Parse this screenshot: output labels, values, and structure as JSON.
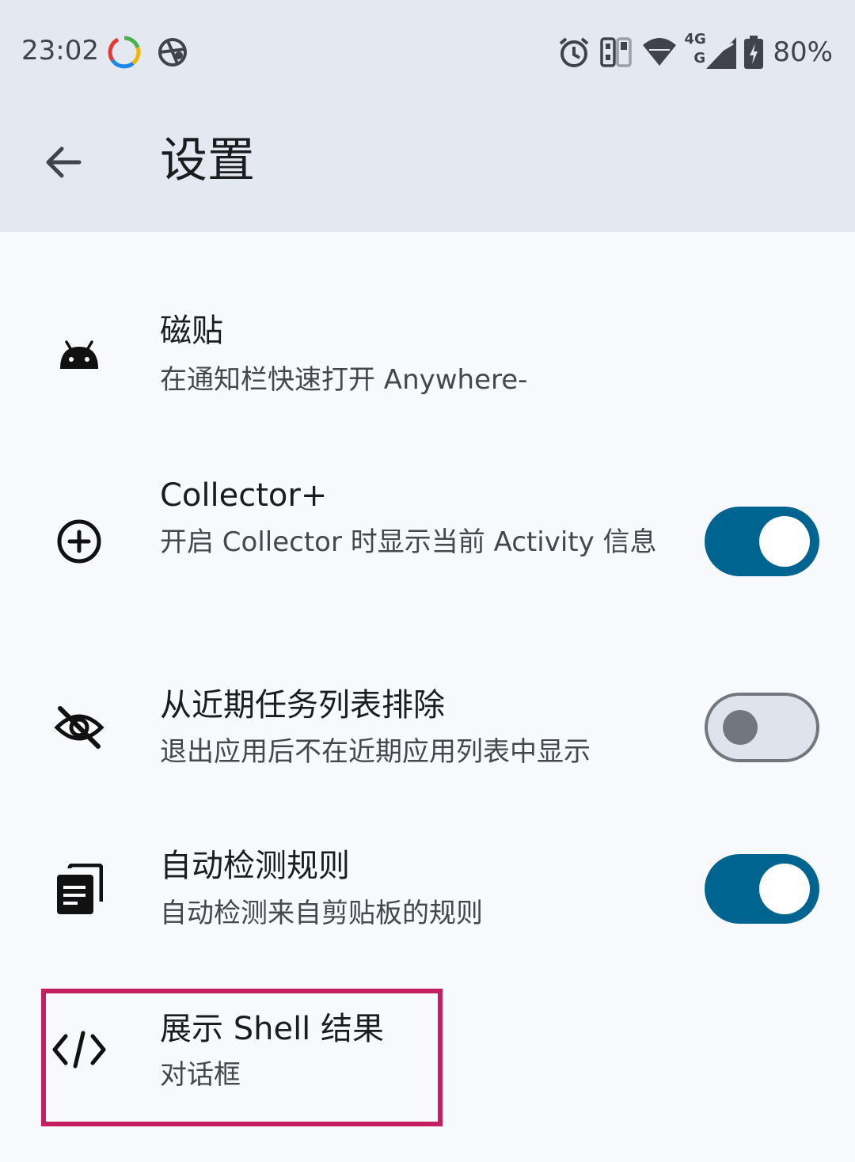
{
  "status_bar": {
    "time": "23:02",
    "left_icons": [
      "sync-ring-icon",
      "vpn-globe-icon"
    ],
    "right_icons": [
      "alarm-icon",
      "sim-cards-icon",
      "wifi-icon",
      "cellular-4g-icon",
      "battery-charging-icon"
    ],
    "network_label_top": "4G",
    "network_label_bottom": "G",
    "battery": "80%"
  },
  "app_bar": {
    "back_icon": "arrow-back-icon",
    "title": "设置"
  },
  "preferences": [
    {
      "icon": "android-icon",
      "title": "磁贴",
      "summary": "在通知栏快速打开 Anywhere-",
      "has_toggle": false
    },
    {
      "icon": "add-circle-icon",
      "title": "Collector+",
      "summary": "开启 Collector 时显示当前 Activity 信息",
      "has_toggle": true,
      "checked": true
    },
    {
      "icon": "eye-off-icon",
      "title": "从近期任务列表排除",
      "summary": "退出应用后不在近期应用列表中显示",
      "has_toggle": true,
      "checked": false
    },
    {
      "icon": "clipboard-copy-icon",
      "title": "自动检测规则",
      "summary": "自动检测来自剪贴板的规则",
      "has_toggle": true,
      "checked": true
    },
    {
      "icon": "code-icon",
      "title": "展示 Shell 结果",
      "summary": "对话框",
      "has_toggle": false
    }
  ],
  "colors": {
    "app_bar_bg": "#e4e9f1",
    "page_bg": "#f8f9fc",
    "toggle_on": "#006490",
    "toggle_off_track": "#dfe3eb",
    "toggle_off_outline": "#72777f",
    "highlight_border": "#c41f60"
  }
}
